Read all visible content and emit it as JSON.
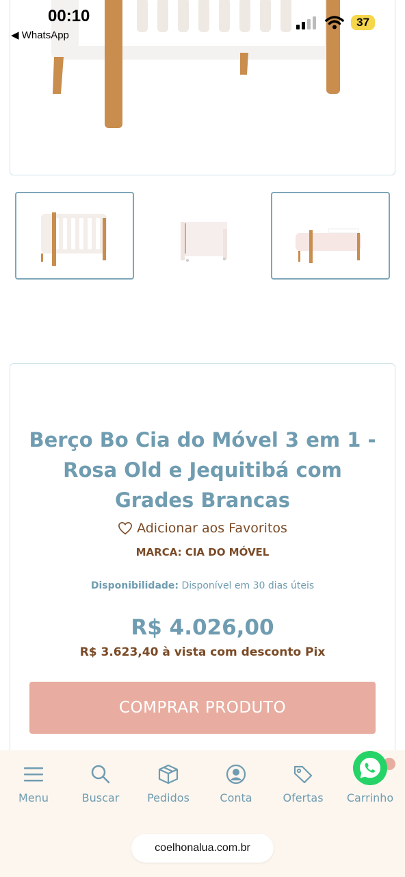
{
  "status_bar": {
    "time": "00:10",
    "back_app": "◀ WhatsApp",
    "battery": "37"
  },
  "product": {
    "title": "Berço Bo Cia do Móvel 3 em 1 - Rosa Old e Jequitibá com Grades Brancas",
    "favorite_label": "Adicionar aos Favoritos",
    "brand": "MARCA: CIA DO MÓVEL",
    "availability_label": "Disponibilidade:",
    "availability_value": "Disponível em 30 dias úteis",
    "price": "R$ 4.026,00",
    "pix_price": "R$ 3.623,40 à vista com desconto Pix",
    "buy_label": "COMPRAR PRODUTO"
  },
  "bottom_nav": {
    "items": [
      {
        "label": "Menu",
        "icon": "menu-icon"
      },
      {
        "label": "Buscar",
        "icon": "search-icon"
      },
      {
        "label": "Pedidos",
        "icon": "box-icon"
      },
      {
        "label": "Conta",
        "icon": "user-icon"
      },
      {
        "label": "Ofertas",
        "icon": "tag-icon"
      },
      {
        "label": "Carrinho",
        "icon": "cart-icon"
      }
    ]
  },
  "browser": {
    "url": "coelhonalua.com.br"
  },
  "colors": {
    "accent_blue": "#6f9cb0",
    "brown": "#7a4a26",
    "buy_button": "#e8ada0",
    "nav_background": "#fcf6ef",
    "whatsapp_green": "#25d366"
  }
}
